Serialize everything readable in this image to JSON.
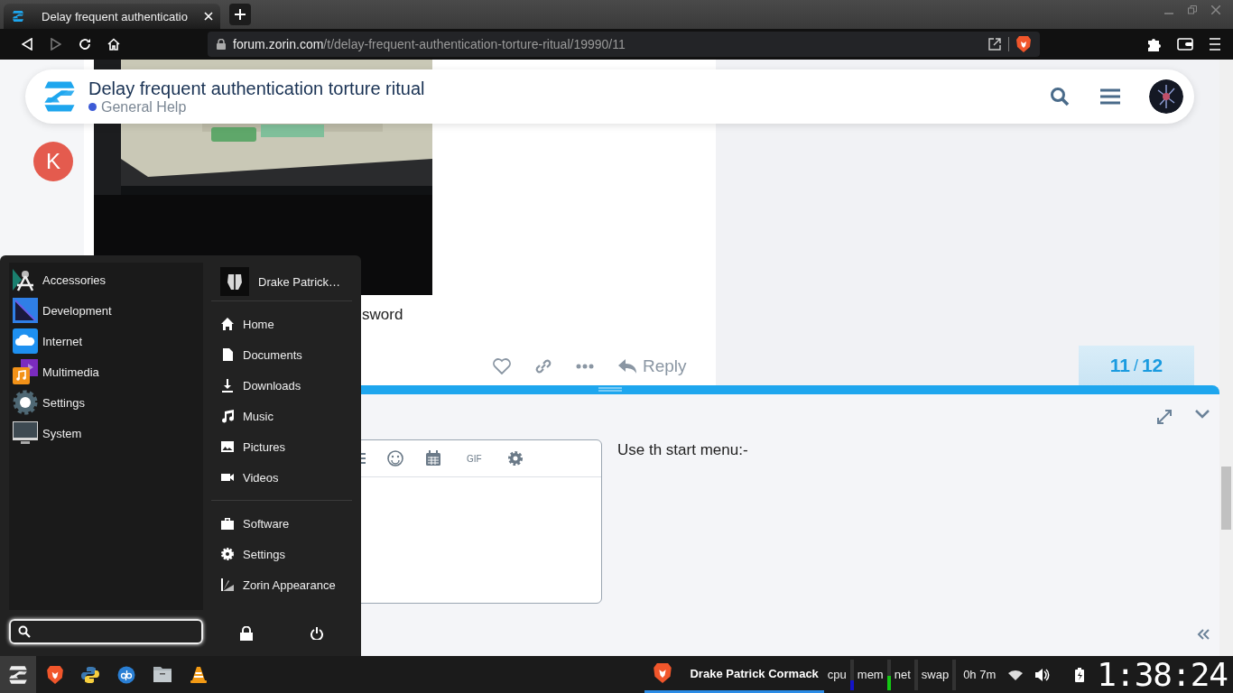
{
  "browser": {
    "tab": {
      "title": "Delay frequent authenticatio"
    },
    "url": {
      "domain": "forum.zorin.com",
      "path": "/t/delay-frequent-authentication-torture-ritual/19990/11"
    }
  },
  "topic_header": {
    "title": "Delay frequent authentication torture ritual",
    "category": "General Help"
  },
  "post": {
    "avatar_letter": "K",
    "text": "sword",
    "reply_label": "Reply"
  },
  "progress": {
    "current": "11",
    "separator": "/",
    "total": "12"
  },
  "composer": {
    "toolbar_label": "GIF",
    "preview": "Use th start menu:-"
  },
  "start_menu": {
    "categories": [
      {
        "label": "Accessories",
        "kind": "accessories"
      },
      {
        "label": "Development",
        "kind": "development"
      },
      {
        "label": "Internet",
        "kind": "internet"
      },
      {
        "label": "Multimedia",
        "kind": "multimedia"
      },
      {
        "label": "Settings",
        "kind": "settings"
      },
      {
        "label": "System",
        "kind": "system"
      }
    ],
    "user_name": "Drake Patrick…",
    "places": [
      {
        "label": "Home",
        "kind": "home"
      },
      {
        "label": "Documents",
        "kind": "document"
      },
      {
        "label": "Downloads",
        "kind": "download"
      },
      {
        "label": "Music",
        "kind": "music"
      },
      {
        "label": "Pictures",
        "kind": "picture"
      },
      {
        "label": "Videos",
        "kind": "video"
      }
    ],
    "system_items": [
      {
        "label": "Software",
        "kind": "software"
      },
      {
        "label": "Settings",
        "kind": "settings"
      },
      {
        "label": "Zorin Appearance",
        "kind": "appearance"
      }
    ]
  },
  "taskbar": {
    "window_title": "Drake Patrick Cormack",
    "monitors": [
      {
        "label": "cpu",
        "level": 0.3,
        "color": "#1414c8"
      },
      {
        "label": "mem",
        "level": 0.45,
        "color": "#14c814"
      },
      {
        "label": "net",
        "level": 0
      },
      {
        "label": "swap",
        "level": 0
      }
    ],
    "uptime": "0h 7m",
    "clock": "1:38:24"
  }
}
